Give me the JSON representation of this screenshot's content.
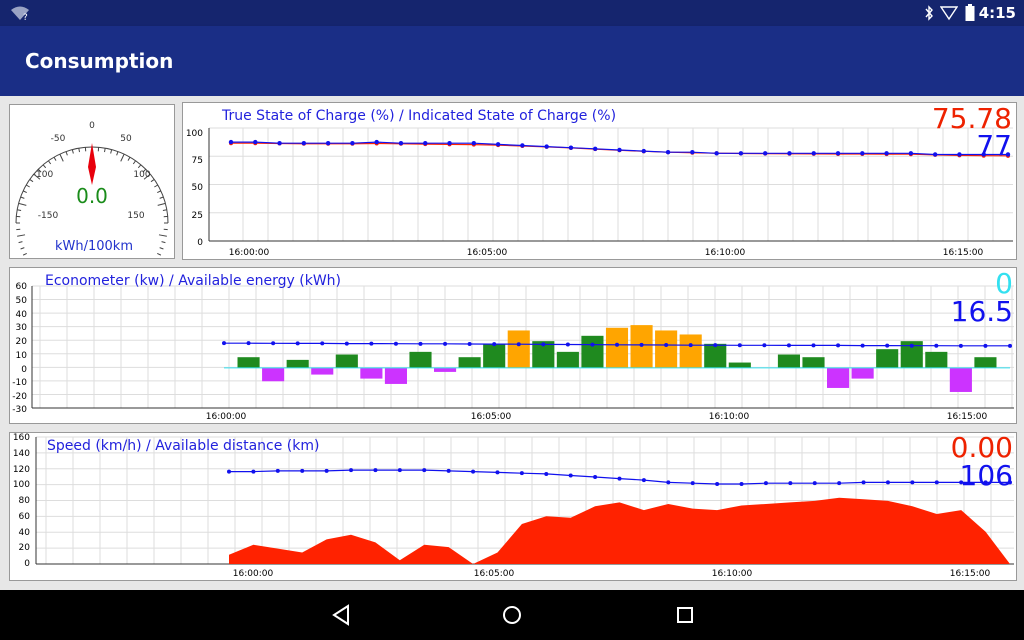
{
  "status_bar": {
    "time": "4:15"
  },
  "app_bar": {
    "title": "Consumption"
  },
  "gauge": {
    "ticks": [
      "-150",
      "-100",
      "-50",
      "0",
      "50",
      "100",
      "150"
    ],
    "value": "0.0",
    "unit": "kWh/100km"
  },
  "charts": {
    "soc": {
      "title": "True State of Charge (%) / Indicated State of Charge (%)",
      "value_primary": "75.78",
      "value_secondary": "77",
      "yticks": [
        "100",
        "75",
        "50",
        "25",
        "0"
      ],
      "xticks": [
        "16:00:00",
        "16:05:00",
        "16:10:00",
        "16:15:00"
      ],
      "colors": {
        "primary": "#ff2200",
        "secondary": "#1111ee"
      }
    },
    "econometer": {
      "title": "Econometer (kw) / Available energy (kWh)",
      "value_primary": "0",
      "value_secondary": "16.5",
      "yticks": [
        "60",
        "50",
        "40",
        "30",
        "20",
        "10",
        "0",
        "-10",
        "-20",
        "-30"
      ],
      "xticks": [
        "16:00:00",
        "16:05:00",
        "16:10:00",
        "16:15:00"
      ],
      "colors": {
        "primary": "#33e0f0",
        "secondary": "#1111ee",
        "positive": "#1f8a1f",
        "high": "#ffa500",
        "peak": "#ff2200",
        "negative": "#cc33ff"
      }
    },
    "speed": {
      "title": "Speed (km/h) / Available distance (km)",
      "value_primary": "0.00",
      "value_secondary": "106",
      "yticks": [
        "160",
        "140",
        "120",
        "100",
        "80",
        "60",
        "40",
        "20",
        "0"
      ],
      "xticks": [
        "16:00:00",
        "16:05:00",
        "16:10:00",
        "16:15:00"
      ],
      "colors": {
        "primary": "#ff2200",
        "secondary": "#1111ee"
      }
    }
  },
  "chart_data": [
    {
      "type": "line",
      "title": "True State of Charge (%) / Indicated State of Charge (%)",
      "x_unit": "minutes after 16:00:00",
      "x": [
        0,
        1,
        2,
        3,
        4,
        5,
        6,
        7,
        8,
        9,
        10,
        11,
        12,
        13,
        14,
        15,
        16,
        17,
        18,
        19,
        20,
        21,
        22,
        23,
        24,
        25,
        26,
        27,
        28,
        29,
        30,
        31,
        32
      ],
      "series": [
        {
          "name": "True State of Charge (%)",
          "values": [
            87,
            87,
            86.8,
            86.5,
            86.5,
            86.5,
            86.8,
            86.5,
            86.2,
            86,
            85.8,
            85.3,
            84.5,
            83.7,
            82.8,
            81.8,
            80.7,
            79.8,
            79,
            78.5,
            78.1,
            77.9,
            77.8,
            77.6,
            77.5,
            77.4,
            77.4,
            77.3,
            77.2,
            76.6,
            76.2,
            75.9,
            75.78
          ]
        },
        {
          "name": "Indicated State of Charge (%)",
          "values": [
            88,
            88,
            87,
            87,
            87,
            87,
            88,
            87,
            87,
            87,
            87,
            86,
            85,
            84,
            83,
            82,
            81,
            80,
            79,
            79,
            78,
            78,
            78,
            78,
            78,
            78,
            78,
            78,
            78,
            77,
            77,
            77,
            77
          ]
        }
      ],
      "yticks": [
        0,
        25,
        50,
        75,
        100
      ],
      "ylim": [
        0,
        105
      ],
      "xticks": [
        "16:00:00",
        "16:05:00",
        "16:10:00",
        "16:15:00"
      ]
    },
    {
      "type": "area",
      "title": "Econometer (kw) / Available energy (kWh)",
      "x_unit": "minutes after 16:00:00",
      "x": [
        0,
        1,
        2,
        3,
        4,
        5,
        6,
        7,
        8,
        9,
        10,
        11,
        12,
        13,
        14,
        15,
        16,
        17,
        18,
        19,
        20,
        21,
        22,
        23,
        24,
        25,
        26,
        27,
        28,
        29,
        30,
        31,
        32
      ],
      "series": [
        {
          "name": "Econometer (kw)",
          "values": [
            0,
            8,
            -10,
            6,
            -5,
            10,
            -8,
            -12,
            12,
            -3,
            8,
            18,
            28,
            20,
            12,
            24,
            30,
            32,
            28,
            25,
            18,
            4,
            0,
            10,
            8,
            -15,
            -8,
            14,
            20,
            12,
            -18,
            8,
            0
          ]
        },
        {
          "name": "Available energy (kWh)",
          "values": [
            18.5,
            18.5,
            18.4,
            18.3,
            18.3,
            18.2,
            18.2,
            18.1,
            18,
            18,
            17.9,
            17.8,
            17.7,
            17.6,
            17.5,
            17.4,
            17.3,
            17.2,
            17.1,
            17,
            17,
            16.9,
            16.9,
            16.8,
            16.8,
            16.8,
            16.7,
            16.7,
            16.6,
            16.6,
            16.5,
            16.5,
            16.5
          ]
        }
      ],
      "yticks": [
        -30,
        -20,
        -10,
        0,
        10,
        20,
        30,
        40,
        50,
        60
      ],
      "ylim": [
        -30,
        65
      ],
      "xticks": [
        "16:00:00",
        "16:05:00",
        "16:10:00",
        "16:15:00"
      ]
    },
    {
      "type": "area",
      "title": "Speed (km/h) / Available distance (km)",
      "x_unit": "minutes after 16:00:00",
      "x": [
        0,
        1,
        2,
        3,
        4,
        5,
        6,
        7,
        8,
        9,
        10,
        11,
        12,
        13,
        14,
        15,
        16,
        17,
        18,
        19,
        20,
        21,
        22,
        23,
        24,
        25,
        26,
        27,
        28,
        29,
        30,
        31,
        32
      ],
      "series": [
        {
          "name": "Speed (km/h)",
          "values": [
            12,
            25,
            20,
            15,
            32,
            38,
            28,
            5,
            25,
            22,
            0,
            15,
            52,
            62,
            60,
            75,
            80,
            70,
            78,
            72,
            70,
            76,
            78,
            80,
            82,
            86,
            84,
            82,
            75,
            65,
            70,
            42,
            0
          ]
        },
        {
          "name": "Available distance (km)",
          "values": [
            120,
            120,
            121,
            121,
            121,
            122,
            122,
            122,
            122,
            121,
            120,
            119,
            118,
            117,
            115,
            113,
            111,
            109,
            106,
            105,
            104,
            104,
            105,
            105,
            105,
            105,
            106,
            106,
            106,
            106,
            106,
            106,
            106
          ]
        }
      ],
      "yticks": [
        0,
        20,
        40,
        60,
        80,
        100,
        120,
        140,
        160
      ],
      "ylim": [
        0,
        165
      ],
      "xticks": [
        "16:00:00",
        "16:05:00",
        "16:10:00",
        "16:15:00"
      ]
    }
  ]
}
